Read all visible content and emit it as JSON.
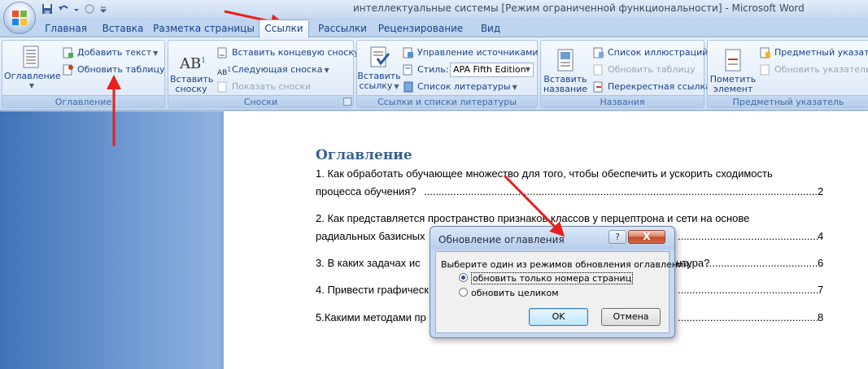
{
  "window": {
    "title": "интеллектуальные системы [Режим ограниченной функциональности] - Microsoft Word"
  },
  "tabs": [
    {
      "label": "Главная",
      "active": false
    },
    {
      "label": "Вставка",
      "active": false
    },
    {
      "label": "Разметка страницы",
      "active": false
    },
    {
      "label": "Ссылки",
      "active": true
    },
    {
      "label": "Рассылки",
      "active": false
    },
    {
      "label": "Рецензирование",
      "active": false
    },
    {
      "label": "Вид",
      "active": false
    }
  ],
  "ribbon": {
    "toc_group": {
      "label": "Оглавление",
      "toc_button": "Оглавление",
      "add_text": "Добавить текст",
      "update_table": "Обновить таблицу"
    },
    "footnotes_group": {
      "label": "Сноски",
      "insert_footnote_line1": "Вставить",
      "insert_footnote_line2": "сноску",
      "insert_endnote": "Вставить концевую сноску",
      "next_footnote": "Следующая сноска",
      "show_notes": "Показать сноски"
    },
    "citations_group": {
      "label": "Ссылки и списки литературы",
      "insert_citation_line1": "Вставить",
      "insert_citation_line2": "ссылку",
      "manage_sources": "Управление источниками",
      "style_label": "Стиль:",
      "style_value": "APA Fifth Edition",
      "bibliography": "Список литературы"
    },
    "captions_group": {
      "label": "Названия",
      "insert_caption_line1": "Вставить",
      "insert_caption_line2": "название",
      "insert_table_of_figures": "Список иллюстраций",
      "update_table": "Обновить таблицу",
      "cross_reference": "Перекрестная ссылка"
    },
    "index_group": {
      "label": "Предметный указатель",
      "mark_entry_line1": "Пометить",
      "mark_entry_line2": "элемент",
      "insert_index": "Предметный указатель",
      "update_index": "Обновить указатель"
    }
  },
  "document": {
    "toc_heading": "Оглавление",
    "entries": [
      {
        "line1": "1.      Как обработать обучающее множество для того, чтобы обеспечить и ускорить сходимость",
        "line2": "процесса обучения?",
        "page": "2"
      },
      {
        "line1": "2.      Как представляется пространство признаков классов у перцептрона и сети на основе",
        "line2": "радиальных базисных",
        "page": "4"
      },
      {
        "line1": "3.      В каких задачах ис",
        "line1_tail": "нтура?",
        "page": "6"
      },
      {
        "line1": "4. Привести графическ",
        "page": "7"
      },
      {
        "line1": "5.Какими методами пр",
        "page": "8"
      }
    ]
  },
  "dialog": {
    "title": "Обновление оглавления",
    "help": "?",
    "close": "X",
    "prompt": "Выберите один из режимов обновления оглавления:",
    "option_pages": "обновить только номера страниц",
    "option_all": "обновить целиком",
    "selected": "option_pages",
    "ok": "OK",
    "cancel": "Отмена"
  },
  "colors": {
    "accent": "#15428b",
    "heading": "#365f91",
    "arrow": "#e8201c"
  }
}
